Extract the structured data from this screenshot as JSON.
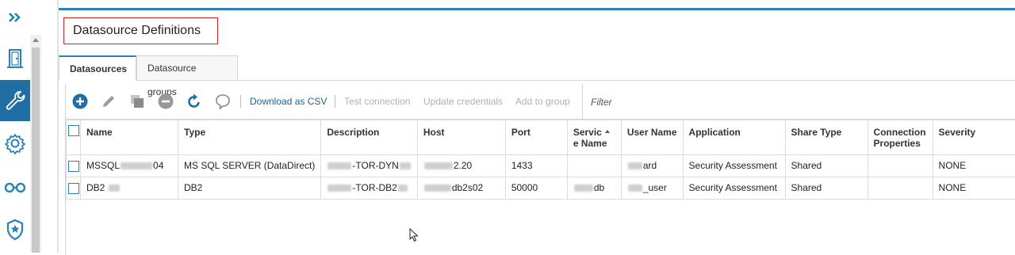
{
  "page": {
    "title": "Datasource Definitions"
  },
  "rail": {
    "icons": [
      "expand-chevrons-icon",
      "door-icon",
      "wrench-icon",
      "gear-icon",
      "glasses-icon",
      "shield-star-icon"
    ],
    "active_color": "#1f6fa3"
  },
  "tabs": [
    {
      "label": "Datasources",
      "active": true
    },
    {
      "label": "Datasource groups",
      "active": false
    }
  ],
  "toolbar": {
    "icons": [
      "add-icon",
      "edit-icon",
      "copy-icon",
      "remove-icon",
      "refresh-icon",
      "comment-icon"
    ],
    "download_csv": "Download as CSV",
    "test_connection": "Test connection",
    "update_credentials": "Update credentials",
    "add_to_group": "Add to group",
    "filter_placeholder": "Filter"
  },
  "table": {
    "columns": [
      "Name",
      "Type",
      "Description",
      "Host",
      "Port",
      "Servic e Name",
      "User Name",
      "Application",
      "Share Type",
      "Connection Properties",
      "Severity"
    ],
    "columns_lines": {
      "service_1": "Servic",
      "service_2": "e Name",
      "conn_1": "Connection",
      "conn_2": "Properties"
    },
    "rows": [
      {
        "name_pre": "MSSQL",
        "name_post": "04",
        "type": "MS SQL SERVER (DataDirect)",
        "desc_post": "-TOR-DYN",
        "host_post": "2.20",
        "port": "1433",
        "service_post": "",
        "user_post": "ard",
        "application": "Security Assessment",
        "share_type": "Shared",
        "conn_props": "",
        "severity": "NONE"
      },
      {
        "name_pre": "DB2",
        "name_post": "",
        "type": "DB2",
        "desc_post": "-TOR-DB2",
        "host_post": "db2s02",
        "port": "50000",
        "service_post": "db",
        "user_post": "_user",
        "application": "Security Assessment",
        "share_type": "Shared",
        "conn_props": "",
        "severity": "NONE"
      }
    ]
  },
  "colors": {
    "accent": "#2a80b9",
    "title_border": "#d21f1f",
    "link": "#1f5f8e",
    "disabled": "#b0b0b0"
  }
}
